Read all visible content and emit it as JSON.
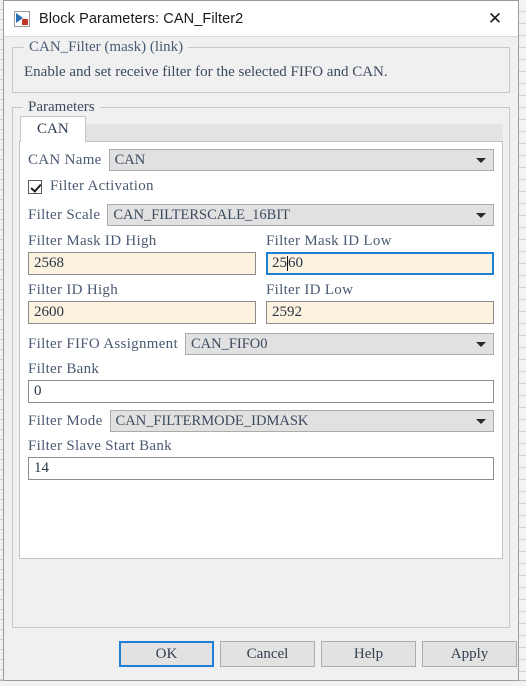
{
  "window": {
    "title": "Block Parameters: CAN_Filter2",
    "icon": "simulink-block-icon",
    "close_label": "✕"
  },
  "mask": {
    "group_title": "CAN_Filter (mask) (link)",
    "description": "Enable and set receive filter for the selected FIFO and CAN."
  },
  "parameters": {
    "group_title": "Parameters",
    "tabs": [
      {
        "label": "CAN",
        "selected": true
      }
    ],
    "fields": {
      "can_name": {
        "label": "CAN Name",
        "value": "CAN",
        "type": "select",
        "disabled": true
      },
      "filter_activation": {
        "label": "Filter Activation",
        "checked": true,
        "type": "checkbox"
      },
      "filter_scale": {
        "label": "Filter Scale",
        "value": "CAN_FILTERSCALE_16BIT",
        "type": "select",
        "disabled": true
      },
      "filter_mask_id_high": {
        "label": "Filter Mask ID High",
        "value": "2568",
        "type": "text",
        "focused": false
      },
      "filter_mask_id_low": {
        "label": "Filter Mask ID Low",
        "value_before_caret": "25",
        "value_after_caret": "60",
        "value": "2560",
        "type": "text",
        "focused": true
      },
      "filter_id_high": {
        "label": "Filter ID High",
        "value": "2600",
        "type": "text",
        "focused": false
      },
      "filter_id_low": {
        "label": "Filter ID Low",
        "value": "2592",
        "type": "text",
        "focused": false
      },
      "filter_fifo_assignment": {
        "label": "Filter FIFO Assignment",
        "value": "CAN_FIFO0",
        "type": "select",
        "disabled": true
      },
      "filter_bank": {
        "label": "Filter Bank",
        "value": "0",
        "type": "text",
        "focused": false
      },
      "filter_mode": {
        "label": "Filter Mode",
        "value": "CAN_FILTERMODE_IDMASK",
        "type": "select",
        "disabled": true
      },
      "filter_slave_start_bank": {
        "label": "Filter Slave Start Bank",
        "value": "14",
        "type": "text",
        "focused": false
      }
    }
  },
  "buttons": {
    "ok": "OK",
    "cancel": "Cancel",
    "help": "Help",
    "apply": "Apply"
  },
  "colors": {
    "focus_blue": "#1f7fd4",
    "field_cream": "#fdf2e0",
    "label_blue_gray": "#4a5a72",
    "dialog_gray": "#f0f0f0"
  }
}
